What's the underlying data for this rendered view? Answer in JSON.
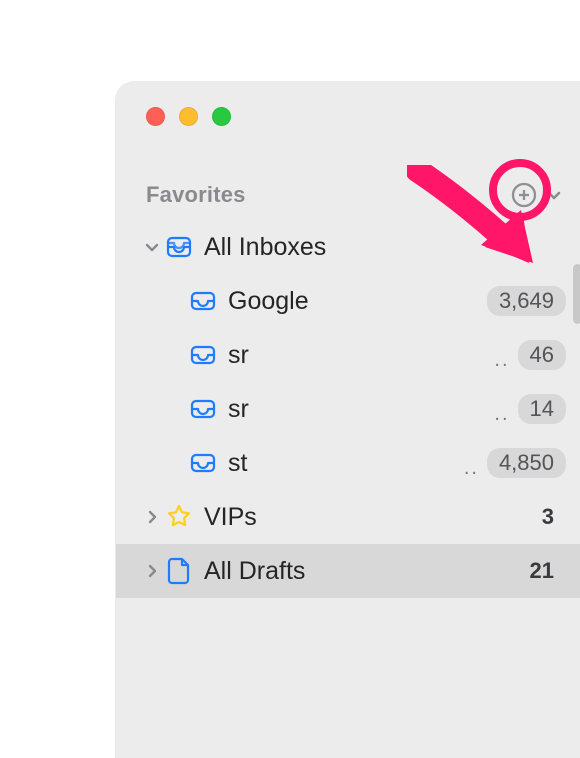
{
  "section": {
    "title": "Favorites"
  },
  "colors": {
    "accent_blue": "#1f7cff",
    "star_yellow": "#ffcf4d",
    "annotation_pink": "#ff1668"
  },
  "sidebar": {
    "items": [
      {
        "label": "All Inboxes",
        "icon": "inbox-stack",
        "expanded": true,
        "children": [
          {
            "label": "Google",
            "icon": "inbox",
            "badge": "3,649",
            "truncated": false
          },
          {
            "label": "sr",
            "icon": "inbox",
            "badge": "46",
            "truncated": true
          },
          {
            "label": "sr",
            "icon": "inbox",
            "badge": "14",
            "truncated": true
          },
          {
            "label": "st",
            "icon": "inbox",
            "badge": "4,850",
            "truncated": true
          }
        ]
      },
      {
        "label": "VIPs",
        "icon": "star",
        "badge": "3",
        "expanded": false
      },
      {
        "label": "All Drafts",
        "icon": "document",
        "badge": "21",
        "expanded": false,
        "selected": true
      }
    ]
  }
}
